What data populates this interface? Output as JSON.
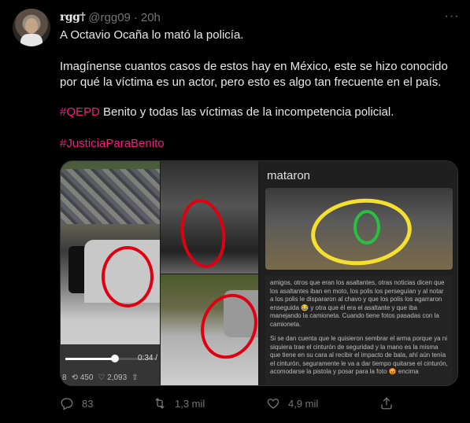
{
  "author": {
    "display_name": "rgg†",
    "handle": "@rgg09",
    "separator": "·",
    "time": "20h"
  },
  "more_label": "···",
  "tweet": {
    "line1": "A Octavio Ocaña lo mató la policía.",
    "line2": "Imagínense cuantos casos de estos hay en México, este se hizo conocido por qué la víctima es un actor, pero esto es algo tan frecuente en el país.",
    "hashtag1": "#QEPD",
    "line3_rest": " Benito y todas las víctimas de la incompetencia policial.",
    "hashtag2": "#JusticiaParaBenito"
  },
  "media": {
    "video_time": "0:34 /",
    "video_stats": [
      "8",
      "⟲ 450",
      "♡ 2,093",
      "⇧"
    ],
    "chat_title": "mataron",
    "chat_para1": "amigos, otros que eran los asaltantes, otras noticias dicen que los asaltantes iban en moto, los polis los perseguían y al notar a los polis le dispararon al chavo y que los polis los agarraron enseguida 😂 y otra que él era el asaltante y que iba manejando la camioneta. Cuando tiene fotos pasadas con la camioneta.",
    "chat_para2": "Si se dan cuenta que le quisieron sembrar el arma porque ya ni siquiera trae el cinturón de seguridad y la mano es la misma que tiene en su cara al recibir el impacto de bala, ahí aún tenía el cinturón, seguramente le va a dar tiempo quitarse el cinturón, acomodarse la pistola y posar para la foto 😡 encima"
  },
  "actions": {
    "reply_count": "83",
    "retweet_count": "1,3 mil",
    "like_count": "4,9 mil"
  },
  "icons": {
    "reply": "reply-icon",
    "retweet": "retweet-icon",
    "like": "like-icon",
    "share": "share-icon",
    "more": "more-icon"
  },
  "colors": {
    "background": "#000000",
    "text": "#e7e9ea",
    "muted": "#71767b",
    "hashtag": "#f91880"
  }
}
